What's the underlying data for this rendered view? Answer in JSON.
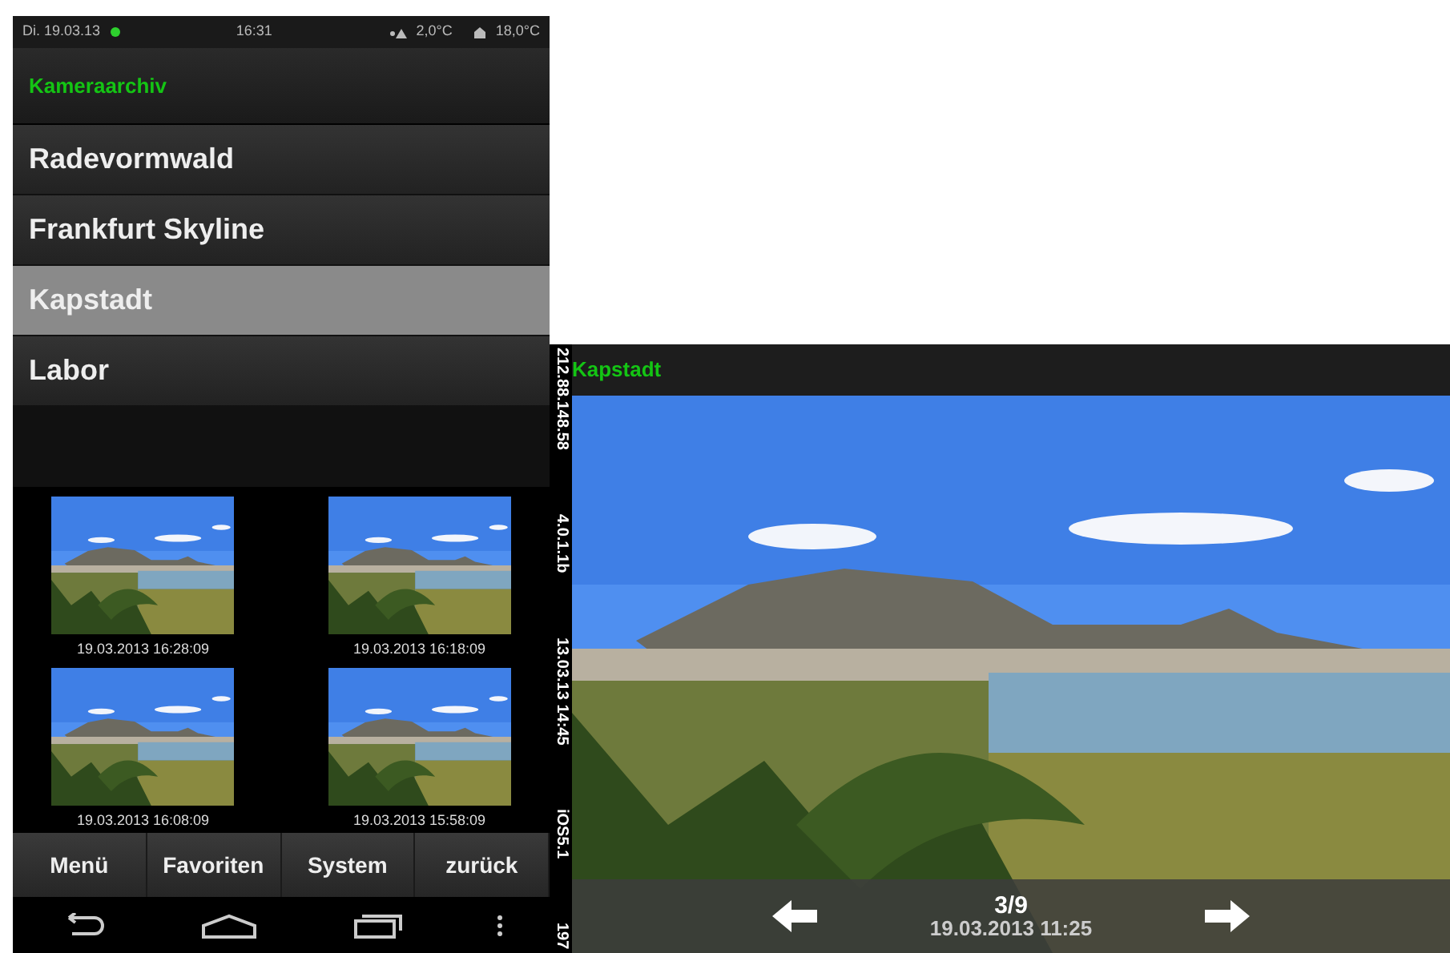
{
  "status_bar": {
    "date": "Di. 19.03.13",
    "time": "16:31",
    "outdoor_temp": "2,0°C",
    "indoor_temp": "18,0°C",
    "online": true
  },
  "archive": {
    "title": "Kameraarchiv",
    "cameras": [
      {
        "label": "Radevormwald",
        "selected": false
      },
      {
        "label": "Frankfurt Skyline",
        "selected": false
      },
      {
        "label": "Kapstadt",
        "selected": true
      },
      {
        "label": "Labor",
        "selected": false
      }
    ],
    "thumbnails": [
      {
        "kind": "picture",
        "caption": "19.03.2013 16:28:09"
      },
      {
        "kind": "picture",
        "caption": "19.03.2013 16:18:09"
      },
      {
        "kind": "picture",
        "caption": "19.03.2013 16:08:09"
      },
      {
        "kind": "picture",
        "caption": "19.03.2013 15:58:09"
      }
    ],
    "buttons": [
      "Menü",
      "Favoriten",
      "System",
      "zurück"
    ]
  },
  "viewer": {
    "title": "Kapstadt",
    "side_info": [
      "212.88.148.58",
      "4.0.1.1b",
      "13.03.13 14:45",
      "iOS5.1",
      "197"
    ],
    "counter": "3/9",
    "timestamp": "19.03.2013 11:25"
  }
}
